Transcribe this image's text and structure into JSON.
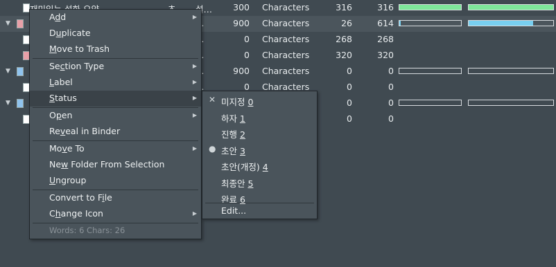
{
  "rows": [
    {
      "name": "재미있는 설화 요약",
      "col1": "초…",
      "col2": "설…",
      "words": "300",
      "unit": "Characters",
      "count": "316",
      "total": "316",
      "icon": "white",
      "indent": 1
    },
    {
      "name": "",
      "col1": "",
      "col2": "…",
      "words": "900",
      "unit": "Characters",
      "count": "26",
      "total": "614",
      "icon": "pink",
      "indent": 0
    },
    {
      "name": "",
      "col1": "",
      "col2": "…",
      "words": "0",
      "unit": "Characters",
      "count": "268",
      "total": "268",
      "icon": "white",
      "indent": 1
    },
    {
      "name": "",
      "col1": "",
      "col2": "…",
      "words": "0",
      "unit": "Characters",
      "count": "320",
      "total": "320",
      "icon": "pink",
      "indent": 1
    },
    {
      "name": "",
      "col1": "",
      "col2": "…",
      "words": "900",
      "unit": "Characters",
      "count": "0",
      "total": "0",
      "icon": "blue",
      "indent": 0
    },
    {
      "name": "",
      "col1": "",
      "col2": "…",
      "words": "0",
      "unit": "Characters",
      "count": "0",
      "total": "0",
      "icon": "white",
      "indent": 1
    },
    {
      "name": "",
      "col1": "",
      "col2": "",
      "words": "",
      "unit": "",
      "count": "0",
      "total": "0",
      "icon": "blue",
      "indent": 0
    },
    {
      "name": "",
      "col1": "",
      "col2": "",
      "words": "",
      "unit": "",
      "count": "0",
      "total": "0",
      "icon": "white",
      "indent": 1
    }
  ],
  "progress": [
    {
      "a": 1.0,
      "b": 1.0,
      "colorA": "#7ee89a",
      "colorB": "#7ee89a"
    },
    {
      "a": 0.02,
      "b": 0.76,
      "colorA": "#78cff0",
      "colorB": "#78cff0"
    },
    null,
    null,
    {
      "a": 0,
      "b": 0
    },
    null,
    {
      "a": 0,
      "b": 0
    },
    null
  ],
  "context_menu": {
    "add": {
      "pre": "A",
      "u": "d",
      "post": "d"
    },
    "duplicate": {
      "pre": "D",
      "u": "u",
      "post": "plicate"
    },
    "move_to_trash": {
      "pre": "",
      "u": "M",
      "post": "ove to Trash"
    },
    "section_type": {
      "pre": "Se",
      "u": "c",
      "post": "tion Type"
    },
    "label": {
      "pre": "",
      "u": "L",
      "post": "abel"
    },
    "status": {
      "pre": "",
      "u": "S",
      "post": "tatus"
    },
    "open": {
      "pre": "O",
      "u": "p",
      "post": "en"
    },
    "reveal": {
      "pre": "Re",
      "u": "v",
      "post": "eal in Binder"
    },
    "move_to": {
      "pre": "Mo",
      "u": "v",
      "post": "e To"
    },
    "new_folder": {
      "pre": "Ne",
      "u": "w",
      "post": " Folder From Selection"
    },
    "ungroup": {
      "pre": "",
      "u": "U",
      "post": "ngroup"
    },
    "convert": {
      "pre": "Convert to F",
      "u": "i",
      "post": "le"
    },
    "change_icon": {
      "pre": "C",
      "u": "h",
      "post": "ange Icon"
    },
    "footer": "Words: 6  Chars: 26"
  },
  "status_menu": {
    "items": [
      {
        "pre": "미지정 ",
        "u": "0",
        "mark": "✕"
      },
      {
        "pre": "하자 ",
        "u": "1",
        "mark": ""
      },
      {
        "pre": "진행 ",
        "u": "2",
        "mark": ""
      },
      {
        "pre": "초안 ",
        "u": "3",
        "mark": "●"
      },
      {
        "pre": "초안(개정) ",
        "u": "4",
        "mark": ""
      },
      {
        "pre": "최종안 ",
        "u": "5",
        "mark": ""
      },
      {
        "pre": "완료 ",
        "u": "6",
        "mark": ""
      }
    ],
    "edit": "Edit..."
  },
  "colors": {
    "background": "#404a51",
    "menu": "#4a545b",
    "highlight": "#3a4248"
  }
}
